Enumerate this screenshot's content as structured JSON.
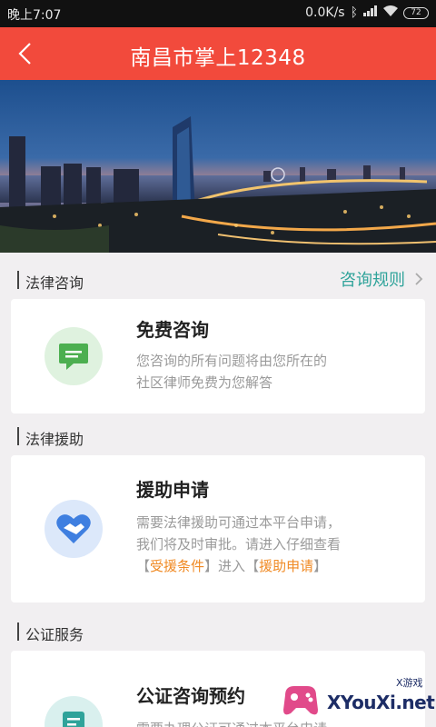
{
  "status_bar": {
    "time": "晚上7:07",
    "network_speed": "0.0K/s",
    "battery": "72"
  },
  "header": {
    "title": "南昌市掌上12348",
    "back_icon": "chevron-left-icon"
  },
  "sections": [
    {
      "label": "法律咨询",
      "link_label": "咨询规则"
    },
    {
      "label": "法律援助"
    },
    {
      "label": "公证服务"
    }
  ],
  "cards": {
    "free_consult": {
      "title": "免费咨询",
      "desc_line1": "您咨询的所有问题将由您所在的",
      "desc_line2": "社区律师免费为您解答",
      "icon": "chat-bubble-icon",
      "icon_color": "#4caf50"
    },
    "aid_apply": {
      "title": "援助申请",
      "desc_line1": "需要法律援助可通过本平台申请，",
      "desc_line2": "我们将及时审批。请进入仔细查看",
      "bracket_open": "【",
      "cond_link": "受援条件",
      "bracket_close": "】",
      "enter_text": "进入",
      "apply_link": "援助申请",
      "icon": "handshake-heart-icon",
      "icon_color": "#3f7fe0"
    },
    "notary": {
      "title": "公证咨询预约",
      "desc_line1": "需要办理公证可通过本平台申请",
      "icon": "document-icon",
      "icon_color": "#2fa39a"
    }
  },
  "watermark": {
    "brand": "XYouXi.net",
    "small": "X游戏"
  },
  "colors": {
    "accent_red": "#f24a3c",
    "teal": "#2fa39a",
    "orange": "#f08a24"
  }
}
